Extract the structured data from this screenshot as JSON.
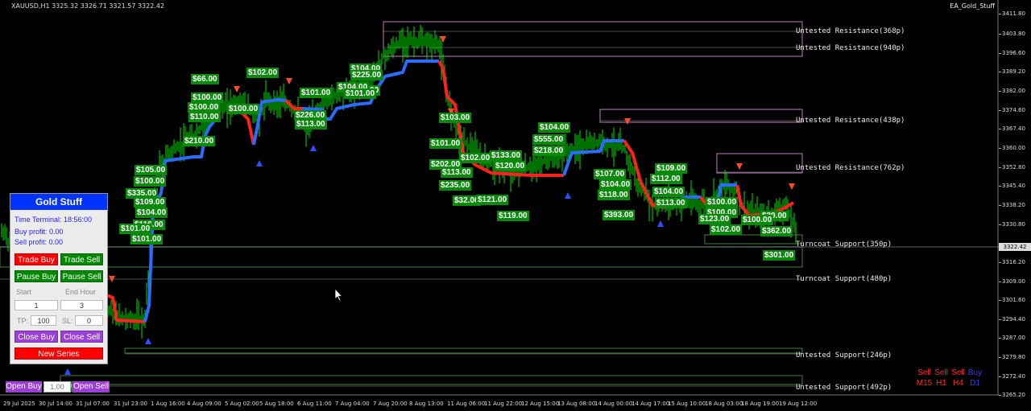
{
  "header": {
    "symbol_info": "XAUUSD,H1  3325.32 3326.71 3321.57 3322.42",
    "ea_name": "EA_Gold_Stuff"
  },
  "price_axis": {
    "ticks": [
      "3411.80",
      "3403.80",
      "3396.60",
      "3389.20",
      "3382.00",
      "3374.60",
      "3367.40",
      "3360.00",
      "3352.80",
      "3345.40",
      "3338.20",
      "3330.80",
      "3316.20",
      "3309.00",
      "3301.60",
      "3294.40",
      "3287.00",
      "3279.80",
      "3272.40",
      "3265.20"
    ],
    "current_price": "3322.42"
  },
  "time_axis": {
    "ticks": [
      "29 Jul 2025",
      "30 Jul 14:00",
      "31 Jul 07:00",
      "31 Jul 23:00",
      "1 Aug 16:00",
      "4 Aug 09:00",
      "5 Aug 02:00",
      "5 Aug 18:00",
      "6 Aug 11:00",
      "7 Aug 04:00",
      "7 Aug 20:00",
      "8 Aug 13:00",
      "11 Aug 06:00",
      "11 Aug 22:00",
      "12 Aug 15:00",
      "13 Aug 08:00",
      "14 Aug 00:00",
      "14 Aug 17:00",
      "15 Aug 10:00",
      "18 Aug 03:00",
      "18 Aug 19:00",
      "19 Aug 12:00"
    ]
  },
  "zones": [
    {
      "label": "Untested Resistance(368p)"
    },
    {
      "label": "Untested Resistance(940p)"
    },
    {
      "label": "Untested Resistance(438p)"
    },
    {
      "label": "Untested Resistance(762p)"
    },
    {
      "label": "Turncoat Support(350p)"
    },
    {
      "label": "Turncoat Support(480p)"
    },
    {
      "label": "Untested Support(246p)"
    },
    {
      "label": "Untested Support(492p)"
    }
  ],
  "profit_labels": [
    "$66.00",
    "$102.00",
    "$100.00",
    "$100.00",
    "$110.00",
    "$100.00",
    "$210.00",
    "$105.00",
    "$100.00",
    "$335.00",
    "$109.00",
    "$104.00",
    "$116.00",
    "$101.00",
    "$101.00",
    "$104.00",
    "$225.00",
    "$101.00",
    "$104.00",
    "$101.00",
    "$226.00",
    "$101.00",
    "$113.00",
    "$103.00",
    "$101.00",
    "$102.00",
    "$202.00",
    "$133.00",
    "$113.00",
    "$120.00",
    "$235.00",
    "$32.00",
    "$121.00",
    "$119.00",
    "$104.00",
    "$555.00",
    "$218.00",
    "$107.00",
    "$104.00",
    "$118.00",
    "$109.00",
    "$112.00",
    "$104.00",
    "$113.00",
    "$393.00",
    "$100.00",
    "$100.00",
    "$123.00",
    "$102.00",
    "$39.00",
    "$100.00",
    "$362.00",
    "$301.00",
    "$115.00",
    "$100.00",
    "$112.00",
    "$1.00"
  ],
  "signal_grid": {
    "directions": [
      "Sell",
      "Sell",
      "Sell",
      "Buy"
    ],
    "timeframes": [
      "M15",
      "H1",
      "H4",
      "D1"
    ]
  },
  "panel": {
    "title": "Gold Stuff",
    "time_terminal": "Time Terminal: 18:56:00",
    "buy_profit": "Buy profit: 0.00",
    "sell_profit": "Sell profit: 0.00",
    "trade_buy": "Trade Buy",
    "trade_sell": "Trade Sell",
    "pause_buy": "Pause Buy",
    "pause_sell": "Pause Sell",
    "start_hour_label": "Start",
    "end_hour_label": "End Hour",
    "start_hour_value": "1",
    "end_hour_value": "3",
    "tp_label": "TP:",
    "tp_value": "100",
    "sl_label": "SL:",
    "sl_value": "0",
    "close_buy": "Close Buy",
    "close_sell": "Close Sell",
    "new_series": "New Series"
  },
  "bottom_bar": {
    "open_buy": "Open Buy",
    "lot_value": "1.00",
    "open_sell": "Open Sell"
  },
  "colors": {
    "background": "#000000",
    "candle": "#00ff00",
    "trend_up": "#2a6cff",
    "trend_down": "#ff2020",
    "zone_border": "#c080c0",
    "support_border": "#3f7f3f",
    "profit_bg": "#0a8a0a"
  }
}
